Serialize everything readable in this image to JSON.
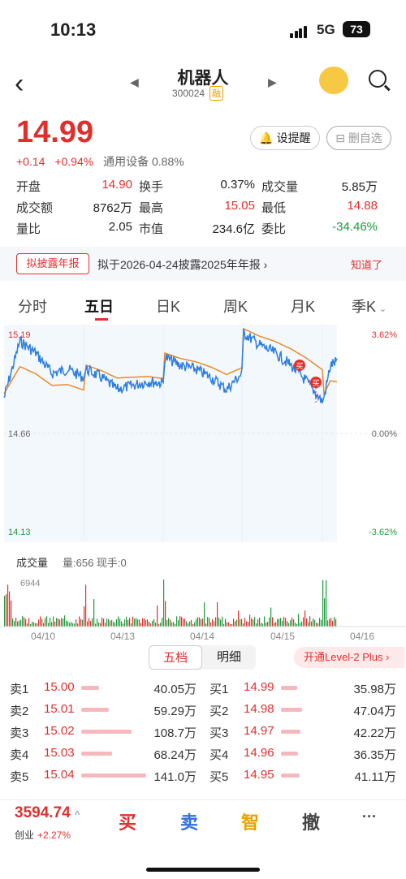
{
  "status": {
    "time": "10:13",
    "network": "5G",
    "battery": "73"
  },
  "nav": {
    "title": "机器人",
    "code": "300024",
    "badge": "融"
  },
  "quote": {
    "price": "14.99",
    "change": "+0.14",
    "pct": "+0.94%",
    "industry": "通用设备 0.88%",
    "remind": "设提醒",
    "delete": "删自选"
  },
  "stats": [
    [
      {
        "k": "开盘",
        "v": "14.90",
        "c": "red"
      },
      {
        "k": "换手",
        "v": "0.37%",
        "c": ""
      },
      {
        "k": "成交量",
        "v": "5.85万",
        "c": ""
      }
    ],
    [
      {
        "k": "成交额",
        "v": "8762万",
        "c": ""
      },
      {
        "k": "最高",
        "v": "15.05",
        "c": "red"
      },
      {
        "k": "最低",
        "v": "14.88",
        "c": "red"
      }
    ],
    [
      {
        "k": "量比",
        "v": "2.05",
        "c": ""
      },
      {
        "k": "市值",
        "v": "234.6亿",
        "c": ""
      },
      {
        "k": "委比",
        "v": "-34.46%",
        "c": "grn"
      }
    ]
  ],
  "notice": {
    "tag": "拟披露年报",
    "text": "拟于2026-04-24披露2025年年报",
    "ok": "知道了"
  },
  "tabs": [
    "分时",
    "五日",
    "日K",
    "周K",
    "月K",
    "季K"
  ],
  "chart": {
    "ymax": "15.19",
    "ymid": "14.66",
    "ymin": "14.13",
    "pmax": "3.62%",
    "pmid": "0.00%",
    "pmin": "-3.62%",
    "buy": "买"
  },
  "volume": {
    "label": "成交量",
    "info": "量:656 现手:0",
    "max": "6944"
  },
  "dates": [
    "04/10",
    "04/13",
    "04/14",
    "04/15",
    "04/16"
  ],
  "orderbook": {
    "tab1": "五档",
    "tab2": "明细",
    "level2": "开通Level-2 Plus",
    "rows": [
      {
        "s": "卖1",
        "sp": "15.00",
        "sv": "40.05万",
        "sw": 0.28,
        "b": "买1",
        "bp": "14.99",
        "bv": "35.98万",
        "bw": 0.25
      },
      {
        "s": "卖2",
        "sp": "15.01",
        "sv": "59.29万",
        "sw": 0.42,
        "b": "买2",
        "bp": "14.98",
        "bv": "47.04万",
        "bw": 0.33
      },
      {
        "s": "卖3",
        "sp": "15.02",
        "sv": "108.7万",
        "sw": 0.77,
        "b": "买3",
        "bp": "14.97",
        "bv": "42.22万",
        "bw": 0.3
      },
      {
        "s": "卖4",
        "sp": "15.03",
        "sv": "68.24万",
        "sw": 0.48,
        "b": "买4",
        "bp": "14.96",
        "bv": "36.35万",
        "bw": 0.26
      },
      {
        "s": "卖5",
        "sp": "15.04",
        "sv": "141.0万",
        "sw": 1.0,
        "b": "买5",
        "bp": "14.95",
        "bv": "41.11万",
        "bw": 0.29
      }
    ]
  },
  "bottom": {
    "index": "3594.74",
    "name": "创业",
    "pct": "+2.27%",
    "buy": "买",
    "sell": "卖",
    "smart": "智",
    "cancel": "撤",
    "more": "···"
  }
}
